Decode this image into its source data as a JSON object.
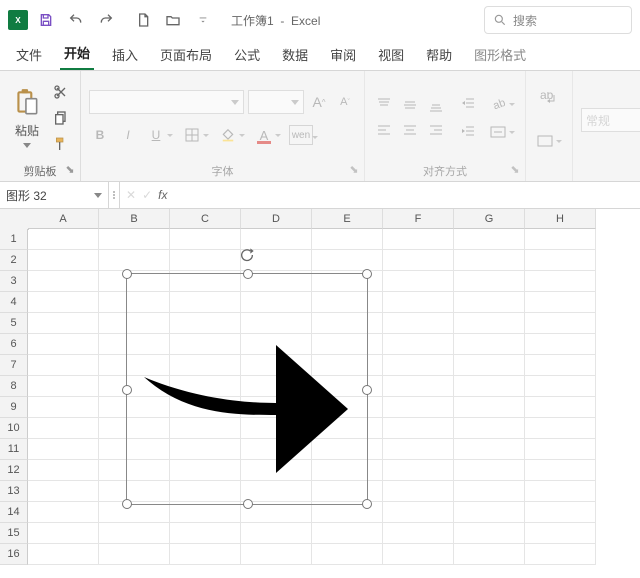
{
  "title": {
    "doc": "工作簿1",
    "app": "Excel"
  },
  "search": {
    "placeholder": "搜索"
  },
  "tabs": {
    "items": [
      "文件",
      "开始",
      "插入",
      "页面布局",
      "公式",
      "数据",
      "审阅",
      "视图",
      "帮助",
      "图形格式"
    ],
    "active": 1,
    "context_index": 9
  },
  "ribbon": {
    "clipboard": {
      "paste": "粘贴",
      "label": "剪贴板"
    },
    "font": {
      "label": "字体",
      "buttons": {
        "bold": "B",
        "italic": "I",
        "underline": "U",
        "wen": "wen"
      }
    },
    "align": {
      "label": "对齐方式"
    },
    "styles": {
      "label": "常规"
    }
  },
  "namebox": {
    "value": "图形 32"
  },
  "formula_bar": {
    "fx": "fx",
    "value": ""
  },
  "columns": [
    "A",
    "B",
    "C",
    "D",
    "E",
    "F",
    "G",
    "H"
  ],
  "rows": [
    "1",
    "2",
    "3",
    "4",
    "5",
    "6",
    "7",
    "8",
    "9",
    "10",
    "11",
    "12",
    "13",
    "14",
    "15",
    "16"
  ],
  "shape": {
    "name": "right-arrow"
  }
}
